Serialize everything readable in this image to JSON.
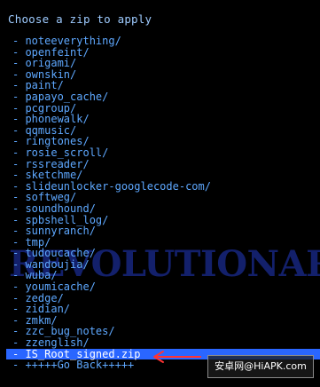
{
  "title": "Choose a zip to apply",
  "watermark": "REVOLUTIONARY",
  "badge": "安卓网@HiAPK.com",
  "items": [
    "- noteeverything/",
    "- openfeint/",
    "- origami/",
    "- ownskin/",
    "- paint/",
    "- papayo_cache/",
    "- pcgroup/",
    "- phonewalk/",
    "- qqmusic/",
    "- ringtones/",
    "- rosie_scroll/",
    "- rssreader/",
    "- sketchme/",
    "- slideunlocker-googlecode-com/",
    "- softweg/",
    "- soundhound/",
    "- spbshell_log/",
    "- sunnyranch/",
    "- tmp/",
    "- tudoucache/",
    "- wandoujia/",
    "- wuba/",
    "- youmicache/",
    "- zedge/",
    "- zidian/",
    "- zmkm/",
    "- zzc_bug_notes/",
    "- zzenglish/",
    "- IS_Root_signed.zip",
    "- +++++Go Back+++++"
  ],
  "selected_index": 28,
  "colors": {
    "background": "#000000",
    "title": "#9ecbff",
    "item": "#5ea8ff",
    "selection": "#2a66ff",
    "arrow": "#ff3333"
  },
  "icons": {
    "arrow": "red-arrow-icon"
  }
}
